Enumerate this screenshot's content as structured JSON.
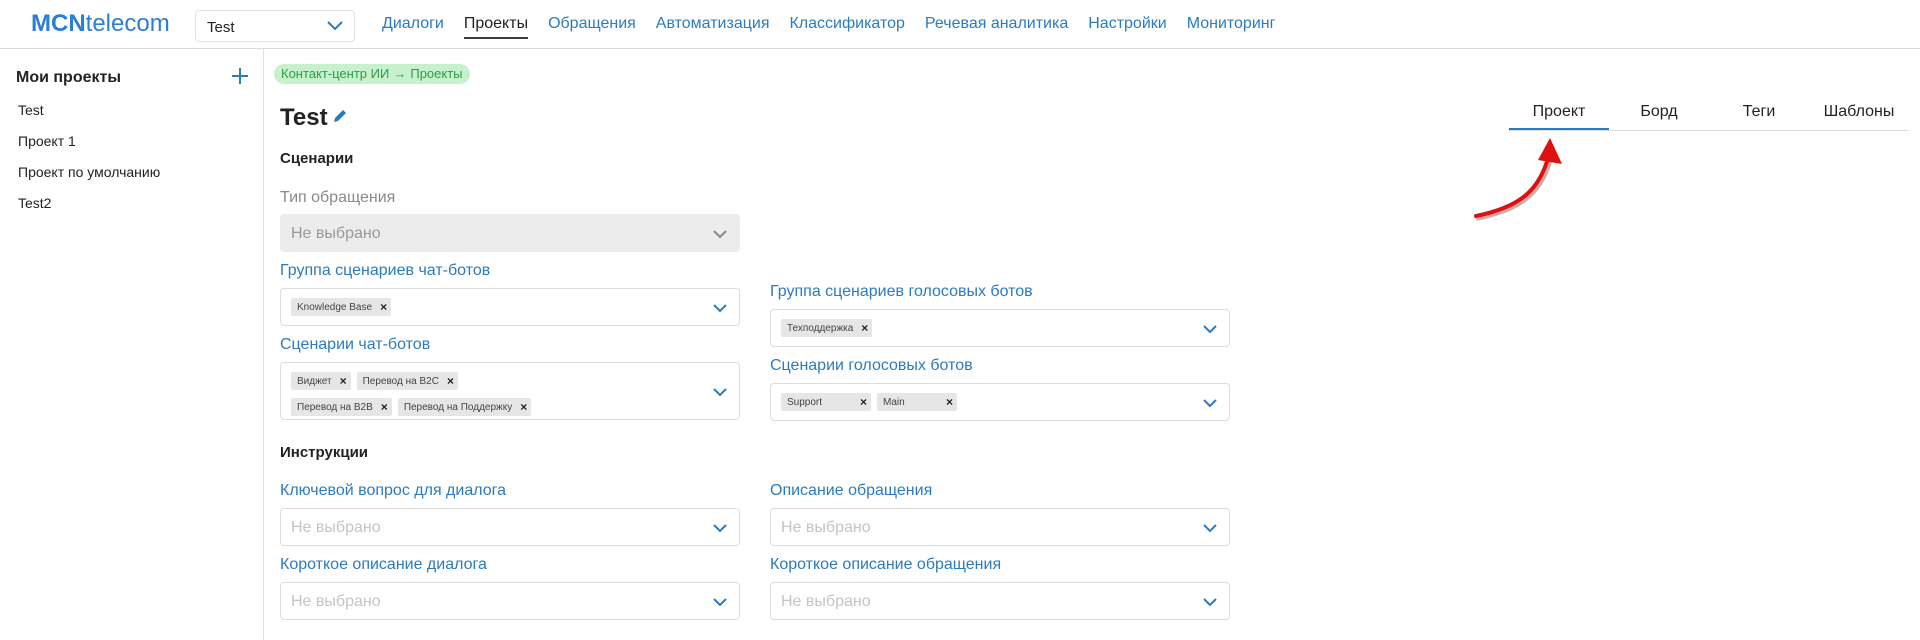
{
  "header": {
    "logo_bold": "MCN",
    "logo_rest": "telecom",
    "project_select_value": "Test",
    "nav": [
      {
        "label": "Диалоги",
        "active": false
      },
      {
        "label": "Проекты",
        "active": true
      },
      {
        "label": "Обращения",
        "active": false
      },
      {
        "label": "Автоматизация",
        "active": false
      },
      {
        "label": "Классификатор",
        "active": false
      },
      {
        "label": "Речевая аналитика",
        "active": false
      },
      {
        "label": "Настройки",
        "active": false
      },
      {
        "label": "Мониторинг",
        "active": false
      }
    ]
  },
  "sidebar": {
    "title": "Мои проекты",
    "items": [
      "Test",
      "Проект 1",
      "Проект по умолчанию",
      "Test2"
    ]
  },
  "breadcrumb": {
    "part1": "Контакт-центр ИИ",
    "separator": "→",
    "part2": "Проекты"
  },
  "page": {
    "title": "Test"
  },
  "tabs": [
    {
      "label": "Проект",
      "active": true
    },
    {
      "label": "Борд",
      "active": false
    },
    {
      "label": "Теги",
      "active": false
    },
    {
      "label": "Шаблоны",
      "active": false
    }
  ],
  "scenarios": {
    "title": "Сценарии",
    "appeal_type": {
      "label": "Тип обращения",
      "placeholder": "Не выбрано"
    },
    "chatbot_group": {
      "label": "Группа сценариев чат-ботов",
      "chips": [
        "Knowledge Base"
      ]
    },
    "chatbot_scenarios": {
      "label": "Сценарии чат-ботов",
      "chips_row1": [
        "Виджет",
        "Перевод на B2C"
      ],
      "chips_row2": [
        "Перевод на B2B",
        "Перевод на Поддержку"
      ]
    },
    "voicebot_group": {
      "label": "Группа сценариев голосовых ботов",
      "chips": [
        "Техподдержка"
      ]
    },
    "voicebot_scenarios": {
      "label": "Сценарии голосовых ботов",
      "chips": [
        "Support",
        "Main"
      ]
    }
  },
  "instructions": {
    "title": "Инструкции",
    "key_question": {
      "label": "Ключевой вопрос для диалога",
      "placeholder": "Не выбрано"
    },
    "appeal_description": {
      "label": "Описание обращения",
      "placeholder": "Не выбрано"
    },
    "short_dialog_description": {
      "label": "Короткое описание диалога",
      "placeholder": "Не выбрано"
    },
    "short_appeal_description": {
      "label": "Короткое описание обращения",
      "placeholder": "Не выбрано"
    }
  },
  "colors": {
    "accent": "#2b7bbf",
    "breadcrumb_bg": "#c7f0cd",
    "breadcrumb_text": "#2f9c4a",
    "annotation_arrow": "#e01010"
  }
}
